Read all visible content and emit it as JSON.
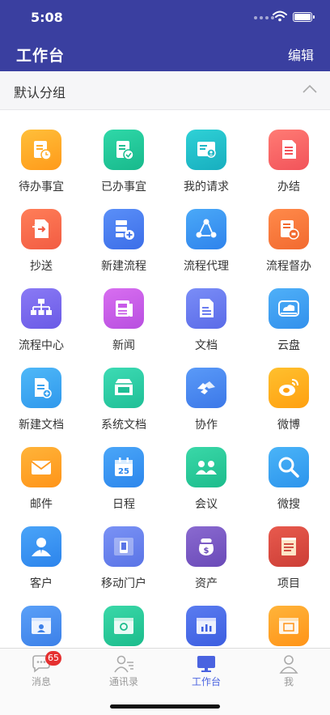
{
  "status_bar": {
    "time": "5:08"
  },
  "header": {
    "title": "工作台",
    "edit_label": "编辑"
  },
  "group": {
    "title": "默认分组"
  },
  "apps": [
    {
      "label": "待办事宜",
      "icon": "todo-icon",
      "color_from": "#ffbf3a",
      "color_to": "#ff9a1a"
    },
    {
      "label": "已办事宜",
      "icon": "done-icon",
      "color_from": "#2fd8a8",
      "color_to": "#18b98c"
    },
    {
      "label": "我的请求",
      "icon": "my-request-icon",
      "color_from": "#2fd1d6",
      "color_to": "#17aebf"
    },
    {
      "label": "办结",
      "icon": "finished-icon",
      "color_from": "#ff7b74",
      "color_to": "#f2535a"
    },
    {
      "label": "抄送",
      "icon": "cc-icon",
      "color_from": "#ff7e58",
      "color_to": "#f25c43"
    },
    {
      "label": "新建流程",
      "icon": "new-flow-icon",
      "color_from": "#5a8ff8",
      "color_to": "#3c6ee8"
    },
    {
      "label": "流程代理",
      "icon": "flow-proxy-icon",
      "color_from": "#4aa9f8",
      "color_to": "#2f83ec"
    },
    {
      "label": "流程督办",
      "icon": "flow-supervise-icon",
      "color_from": "#ff8a4a",
      "color_to": "#f26a30"
    },
    {
      "label": "流程中心",
      "icon": "flow-center-icon",
      "color_from": "#8a7af5",
      "color_to": "#6a5ae6"
    },
    {
      "label": "新闻",
      "icon": "news-icon",
      "color_from": "#d86ef0",
      "color_to": "#b84fe0"
    },
    {
      "label": "文档",
      "icon": "document-icon",
      "color_from": "#7a8df7",
      "color_to": "#5a6be8"
    },
    {
      "label": "云盘",
      "icon": "cloud-disk-icon",
      "color_from": "#4fb0f8",
      "color_to": "#3290ec"
    },
    {
      "label": "新建文档",
      "icon": "new-document-icon",
      "color_from": "#4fb8f8",
      "color_to": "#2f98ec"
    },
    {
      "label": "系统文档",
      "icon": "system-document-icon",
      "color_from": "#3ddbb4",
      "color_to": "#1fbf96"
    },
    {
      "label": "协作",
      "icon": "collaboration-icon",
      "color_from": "#5a9af8",
      "color_to": "#3c78e8"
    },
    {
      "label": "微博",
      "icon": "weibo-icon",
      "color_from": "#ffc02e",
      "color_to": "#ffa010"
    },
    {
      "label": "邮件",
      "icon": "mail-icon",
      "color_from": "#ffb43a",
      "color_to": "#ff9418"
    },
    {
      "label": "日程",
      "icon": "calendar-icon",
      "color_from": "#4aa6f8",
      "color_to": "#2c86ec"
    },
    {
      "label": "会议",
      "icon": "meeting-icon",
      "color_from": "#3ad8a8",
      "color_to": "#1cbc8c"
    },
    {
      "label": "微搜",
      "icon": "search-icon",
      "color_from": "#4ab4f8",
      "color_to": "#2c94ec"
    },
    {
      "label": "客户",
      "icon": "customer-icon",
      "color_from": "#4aa4f8",
      "color_to": "#2c84ec"
    },
    {
      "label": "移动门户",
      "icon": "mobile-portal-icon",
      "color_from": "#7a92f5",
      "color_to": "#5a74e6"
    },
    {
      "label": "资产",
      "icon": "asset-icon",
      "color_from": "#8a6ad0",
      "color_to": "#6a4ab8"
    },
    {
      "label": "项目",
      "icon": "project-icon",
      "color_from": "#e85a4e",
      "color_to": "#cc3e36"
    },
    {
      "label": "",
      "icon": "portal-window-icon",
      "color_from": "#5aa0f8",
      "color_to": "#3c80e8"
    },
    {
      "label": "",
      "icon": "service-window-icon",
      "color_from": "#3ad8a8",
      "color_to": "#1cbc8c"
    },
    {
      "label": "",
      "icon": "report-window-icon",
      "color_from": "#5a7cf0",
      "color_to": "#3c5ee0"
    },
    {
      "label": "",
      "icon": "monitor-window-icon",
      "color_from": "#ffb43a",
      "color_to": "#ff9418"
    }
  ],
  "tabs": [
    {
      "label": "消息",
      "icon": "message-icon",
      "badge": "65",
      "active": false
    },
    {
      "label": "通讯录",
      "icon": "contacts-icon",
      "badge": "",
      "active": false
    },
    {
      "label": "工作台",
      "icon": "workbench-icon",
      "badge": "",
      "active": true
    },
    {
      "label": "我",
      "icon": "profile-icon",
      "badge": "",
      "active": false
    }
  ]
}
